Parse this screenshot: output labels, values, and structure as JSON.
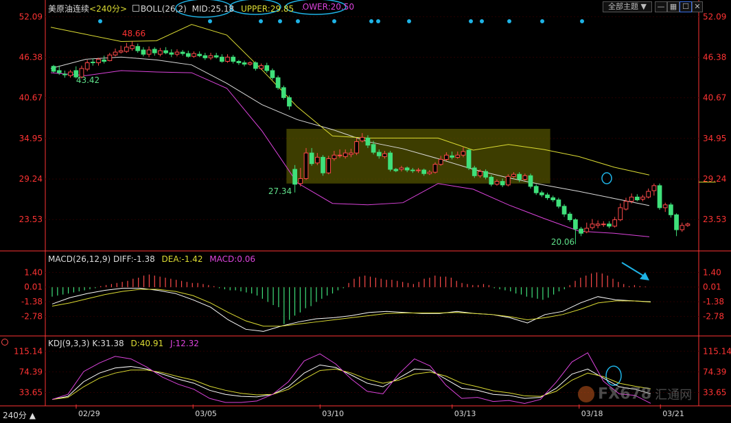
{
  "header": {
    "instrument": "美原油连续",
    "period": "<240分>",
    "boll_label": "BOLL(26,2)",
    "mid": "MID:25.18",
    "upper": "UPPER:29.85",
    "lower": "LOWER:20.50",
    "theme_label": "全部主题",
    "theme_arrow": "▼"
  },
  "macd_header": {
    "label": "MACD(26,12,9)",
    "diff": "DIFF:-1.38",
    "dea": "DEA:-1.42",
    "macd": "MACD:0.06"
  },
  "kdj_header": {
    "label": "KDJ(9,3,3)",
    "k": "K:31.38",
    "d": "D:40.91",
    "j": "J:12.32"
  },
  "footer": {
    "period": "240分 ▲"
  },
  "watermark": {
    "text": "FX678",
    "cn": "汇通网"
  },
  "colors": {
    "up": "#ff4a4a",
    "down": "#3fe07a",
    "mid": "#dddddd",
    "upper": "#dddd33",
    "lower": "#dd44dd",
    "axis": "#ff3333",
    "grid": "#2a0000",
    "highlight": "#666600",
    "annot": "#1eb3e6",
    "label": "#5fe08a"
  },
  "chart_data": [
    {
      "type": "candlestick",
      "title": "美原油连续 <240分> BOLL(26,2)",
      "y_ticks": [
        "52.09",
        "46.38",
        "40.67",
        "34.95",
        "29.24",
        "23.53"
      ],
      "ylim": [
        19.5,
        52.7
      ],
      "x_ticks": [
        "02/29",
        "03/05",
        "03/10",
        "03/13",
        "03/18",
        "03/21"
      ],
      "series": [
        {
          "name": "MID",
          "values": [
            44.8,
            46.1,
            46.4,
            46.0,
            45.3,
            42.7,
            39.7,
            37.6,
            36.2,
            34.5,
            33.5,
            32.1,
            30.6,
            29.4,
            28.4,
            27.5,
            26.5,
            25.5
          ]
        },
        {
          "name": "UPPER",
          "values": [
            50.6,
            49.6,
            48.6,
            48.7,
            51.0,
            49.5,
            44.6,
            39.4,
            35.3,
            35.0,
            35.0,
            35.0,
            33.3,
            34.1,
            33.4,
            32.4,
            30.9,
            29.8
          ]
        },
        {
          "name": "LOWER",
          "values": [
            44.2,
            43.8,
            44.5,
            44.3,
            44.2,
            42.0,
            36.0,
            28.7,
            25.8,
            25.6,
            25.9,
            28.6,
            27.8,
            25.6,
            23.7,
            21.9,
            21.6,
            21.1
          ]
        }
      ],
      "candles": [
        [
          45.1,
          44.4,
          45.3,
          44.2
        ],
        [
          44.5,
          44.2,
          45.2,
          43.9
        ],
        [
          44.0,
          43.9,
          44.5,
          43.5
        ],
        [
          43.8,
          44.3,
          44.6,
          43.5
        ],
        [
          44.5,
          43.6,
          45.1,
          43.4
        ],
        [
          43.6,
          44.8,
          45.2,
          43.4
        ],
        [
          44.7,
          45.6,
          46.0,
          44.4
        ],
        [
          45.7,
          45.6,
          46.2,
          45.2
        ],
        [
          45.6,
          46.1,
          46.3,
          45.2
        ],
        [
          46.0,
          45.8,
          46.6,
          45.5
        ],
        [
          45.9,
          46.7,
          47.0,
          45.8
        ],
        [
          46.7,
          47.1,
          47.6,
          46.5
        ],
        [
          47.1,
          47.3,
          48.0,
          46.9
        ],
        [
          47.2,
          47.8,
          48.4,
          47.0
        ],
        [
          47.6,
          48.0,
          48.6,
          47.3
        ],
        [
          47.9,
          47.3,
          48.3,
          47.0
        ],
        [
          47.4,
          46.8,
          47.8,
          46.5
        ],
        [
          46.8,
          47.4,
          47.9,
          46.4
        ],
        [
          47.5,
          47.0,
          47.8,
          46.6
        ],
        [
          46.8,
          47.3,
          47.7,
          46.5
        ],
        [
          47.3,
          47.0,
          47.8,
          46.8
        ],
        [
          47.0,
          46.8,
          47.5,
          46.4
        ],
        [
          46.8,
          47.1,
          47.5,
          46.5
        ],
        [
          47.1,
          46.9,
          47.4,
          46.6
        ],
        [
          46.9,
          46.5,
          47.3,
          46.3
        ],
        [
          46.5,
          46.9,
          47.2,
          46.3
        ],
        [
          46.8,
          46.6,
          47.2,
          46.4
        ],
        [
          46.6,
          46.3,
          47.0,
          46.0
        ],
        [
          46.3,
          46.6,
          47.0,
          46.0
        ],
        [
          46.6,
          46.4,
          47.0,
          46.2
        ],
        [
          46.4,
          45.8,
          46.8,
          45.6
        ],
        [
          45.8,
          46.4,
          46.8,
          45.6
        ],
        [
          46.4,
          45.8,
          46.7,
          45.5
        ],
        [
          45.8,
          45.6,
          46.0,
          45.3
        ],
        [
          45.6,
          45.4,
          45.9,
          45.1
        ],
        [
          45.4,
          45.6,
          45.8,
          45.2
        ],
        [
          45.6,
          44.8,
          45.8,
          44.5
        ],
        [
          44.8,
          45.2,
          45.5,
          44.6
        ],
        [
          45.2,
          44.5,
          45.6,
          44.2
        ],
        [
          44.5,
          43.5,
          44.8,
          43.2
        ],
        [
          43.5,
          42.1,
          43.8,
          41.8
        ],
        [
          42.1,
          40.7,
          42.4,
          40.4
        ],
        [
          40.7,
          39.5,
          41.0,
          39.0
        ],
        [
          30.6,
          28.5,
          31.2,
          27.34
        ],
        [
          28.6,
          29.3,
          30.8,
          28.2
        ],
        [
          29.3,
          32.9,
          33.6,
          29.1
        ],
        [
          32.9,
          31.4,
          33.6,
          31.1
        ],
        [
          31.5,
          32.3,
          32.9,
          31.2
        ],
        [
          32.3,
          30.1,
          32.6,
          29.7
        ],
        [
          30.1,
          32.1,
          32.5,
          29.9
        ],
        [
          32.1,
          32.6,
          33.2,
          31.8
        ],
        [
          32.6,
          32.6,
          33.4,
          32.2
        ],
        [
          32.4,
          32.9,
          33.4,
          32.1
        ],
        [
          32.7,
          32.9,
          33.5,
          32.3
        ],
        [
          32.9,
          34.5,
          35.0,
          32.6
        ],
        [
          34.6,
          35.1,
          35.7,
          34.4
        ],
        [
          35.0,
          34.0,
          35.4,
          33.6
        ],
        [
          34.1,
          33.0,
          34.6,
          32.7
        ],
        [
          33.0,
          32.5,
          33.4,
          32.1
        ],
        [
          32.4,
          32.8,
          33.2,
          32.1
        ],
        [
          32.9,
          30.6,
          33.2,
          30.3
        ],
        [
          30.6,
          30.4,
          30.8,
          30.2
        ],
        [
          30.6,
          30.8,
          31.1,
          30.3
        ],
        [
          30.8,
          30.5,
          31.0,
          30.2
        ],
        [
          30.5,
          30.4,
          30.8,
          30.1
        ],
        [
          30.4,
          30.5,
          30.8,
          30.1
        ],
        [
          30.5,
          30.0,
          30.7,
          29.7
        ],
        [
          30.0,
          30.2,
          30.5,
          29.8
        ],
        [
          30.2,
          31.3,
          31.6,
          30.0
        ],
        [
          31.3,
          32.0,
          32.5,
          31.1
        ],
        [
          32.0,
          32.6,
          33.0,
          31.8
        ],
        [
          32.5,
          32.3,
          33.1,
          32.0
        ],
        [
          32.3,
          32.6,
          33.1,
          32.1
        ],
        [
          32.6,
          33.1,
          33.7,
          32.3
        ],
        [
          33.3,
          30.8,
          33.5,
          30.5
        ],
        [
          30.8,
          29.7,
          31.1,
          29.4
        ],
        [
          29.7,
          30.3,
          30.6,
          29.4
        ],
        [
          30.3,
          29.5,
          30.6,
          29.2
        ],
        [
          29.5,
          28.5,
          29.8,
          28.2
        ],
        [
          28.5,
          28.9,
          29.2,
          28.3
        ],
        [
          28.9,
          28.4,
          29.3,
          28.1
        ],
        [
          28.4,
          29.6,
          29.9,
          28.2
        ],
        [
          29.6,
          29.9,
          30.2,
          29.4
        ],
        [
          29.9,
          29.2,
          30.2,
          28.8
        ],
        [
          29.2,
          29.7,
          30.0,
          29.0
        ],
        [
          29.7,
          28.2,
          30.0,
          27.9
        ],
        [
          28.2,
          27.3,
          28.5,
          27.0
        ],
        [
          27.3,
          27.0,
          27.6,
          26.7
        ],
        [
          27.0,
          26.6,
          27.3,
          26.3
        ],
        [
          26.6,
          26.3,
          26.9,
          26.0
        ],
        [
          26.3,
          25.4,
          26.6,
          25.1
        ],
        [
          25.4,
          24.3,
          25.7,
          23.9
        ],
        [
          24.3,
          23.5,
          24.6,
          23.2
        ],
        [
          23.5,
          22.2,
          23.7,
          20.06
        ],
        [
          22.2,
          21.6,
          22.5,
          21.2
        ],
        [
          21.8,
          22.3,
          23.1,
          21.6
        ],
        [
          22.4,
          22.9,
          23.6,
          22.1
        ],
        [
          22.7,
          22.9,
          23.4,
          22.3
        ],
        [
          22.9,
          22.9,
          23.3,
          22.5
        ],
        [
          22.9,
          22.6,
          23.3,
          22.3
        ],
        [
          22.6,
          23.5,
          23.9,
          22.4
        ],
        [
          23.5,
          25.2,
          25.8,
          23.3
        ],
        [
          25.0,
          26.1,
          26.6,
          24.8
        ],
        [
          26.1,
          26.7,
          27.2,
          25.8
        ],
        [
          26.7,
          26.3,
          27.1,
          26.1
        ],
        [
          26.4,
          26.7,
          27.0,
          26.1
        ],
        [
          26.7,
          27.5,
          27.9,
          26.5
        ],
        [
          27.6,
          28.3,
          28.6,
          26.9
        ],
        [
          28.3,
          25.2,
          28.6,
          24.9
        ],
        [
          25.2,
          25.6,
          25.9,
          24.6
        ],
        [
          25.6,
          24.2,
          25.9,
          23.8
        ],
        [
          24.2,
          22.1,
          24.4,
          21.2
        ],
        [
          22.1,
          22.7,
          23.1,
          21.8
        ],
        [
          22.7,
          22.9,
          23.1,
          22.5
        ]
      ],
      "annotations": [
        "48.66",
        "43.42",
        "27.34",
        "20.06"
      ],
      "reference_line": 28.8,
      "highlight_box": {
        "x_from": 42,
        "x_to": 89,
        "y_from": 28.6,
        "y_to": 36.3
      }
    },
    {
      "type": "bar+line",
      "title": "MACD(26,12,9)",
      "y_ticks": [
        "1.40",
        "0.01",
        "-1.38",
        "-2.78"
      ],
      "ylim": [
        -4.5,
        2.4
      ],
      "histogram_bars": [
        -0.9,
        -0.8,
        -0.7,
        -0.6,
        -0.5,
        -0.4,
        -0.3,
        -0.2,
        -0.1,
        0.1,
        0.2,
        0.3,
        0.4,
        0.5,
        0.6,
        0.8,
        0.9,
        1.1,
        1.2,
        1.1,
        1.0,
        0.9,
        0.8,
        0.7,
        0.6,
        0.5,
        0.4,
        0.4,
        0.3,
        0.2,
        0.1,
        -0.1,
        -0.2,
        -0.3,
        -0.3,
        -0.4,
        -0.5,
        -0.6,
        -0.8,
        -1.1,
        -1.4,
        -1.7,
        -1.9,
        -3.5,
        -3.1,
        -2.7,
        -2.4,
        -2.0,
        -1.8,
        -1.4,
        -1.1,
        -0.8,
        -0.6,
        -0.3,
        -0.1,
        0.4,
        0.8,
        1.0,
        1.1,
        1.0,
        0.9,
        0.8,
        0.7,
        0.7,
        0.6,
        0.5,
        0.4,
        0.3,
        0.5,
        0.8,
        0.9,
        1.1,
        1.0,
        1.0,
        0.9,
        0.6,
        0.4,
        0.3,
        0.2,
        0.2,
        0.3,
        0.2,
        -0.1,
        -0.2,
        -0.3,
        -0.4,
        -0.6,
        -0.7,
        -0.9,
        -1.0,
        -1.1,
        -1.2,
        -1.0,
        -0.7,
        -0.4,
        -0.2,
        0.2,
        0.6,
        0.9,
        1.1,
        1.3,
        1.4,
        1.3,
        1.1,
        0.8,
        0.5,
        0.3,
        0.1,
        0.2,
        0.1,
        0.06
      ],
      "series": [
        {
          "name": "DIFF",
          "values": [
            -1.6,
            -1.0,
            -0.6,
            -0.3,
            -0.1,
            -0.1,
            -0.3,
            -0.6,
            -1.2,
            -1.9,
            -3.1,
            -4.0,
            -4.2,
            -3.7,
            -3.3,
            -3.0,
            -2.9,
            -2.7,
            -2.4,
            -2.3,
            -2.4,
            -2.5,
            -2.5,
            -2.3,
            -2.5,
            -2.6,
            -2.9,
            -3.4,
            -2.6,
            -2.3,
            -1.5,
            -0.9,
            -1.2,
            -1.3,
            -1.38
          ]
        },
        {
          "name": "DEA",
          "values": [
            -1.8,
            -1.5,
            -1.1,
            -0.7,
            -0.4,
            -0.2,
            -0.2,
            -0.4,
            -0.8,
            -1.5,
            -2.4,
            -3.2,
            -3.7,
            -3.7,
            -3.5,
            -3.3,
            -3.1,
            -2.9,
            -2.7,
            -2.5,
            -2.45,
            -2.45,
            -2.45,
            -2.4,
            -2.5,
            -2.6,
            -2.8,
            -3.1,
            -2.9,
            -2.6,
            -2.1,
            -1.5,
            -1.3,
            -1.3,
            -1.42
          ]
        }
      ]
    },
    {
      "type": "line",
      "title": "KDJ(9,3,3)",
      "y_ticks": [
        "115.14",
        "74.39",
        "33.65"
      ],
      "ylim": [
        10,
        125
      ],
      "series": [
        {
          "name": "K",
          "values": [
            20,
            26,
            55,
            72,
            82,
            85,
            80,
            70,
            60,
            52,
            38,
            30,
            26,
            25,
            30,
            45,
            72,
            88,
            83,
            68,
            52,
            45,
            62,
            80,
            78,
            60,
            42,
            38,
            30,
            28,
            22,
            24,
            42,
            70,
            80,
            62,
            45,
            40,
            31.38
          ]
        },
        {
          "name": "D",
          "values": [
            20,
            24,
            45,
            62,
            72,
            78,
            78,
            73,
            65,
            58,
            46,
            38,
            32,
            29,
            30,
            40,
            60,
            77,
            80,
            72,
            60,
            52,
            58,
            70,
            74,
            66,
            52,
            45,
            37,
            33,
            27,
            26,
            36,
            58,
            72,
            65,
            52,
            46,
            40.91
          ]
        },
        {
          "name": "J",
          "values": [
            20,
            30,
            75,
            92,
            105,
            100,
            84,
            64,
            50,
            40,
            22,
            14,
            14,
            17,
            30,
            55,
            96,
            110,
            90,
            60,
            36,
            31,
            70,
            100,
            86,
            48,
            22,
            24,
            16,
            18,
            12,
            20,
            54,
            94,
            112,
            56,
            31,
            28,
            12.32
          ]
        }
      ]
    }
  ]
}
